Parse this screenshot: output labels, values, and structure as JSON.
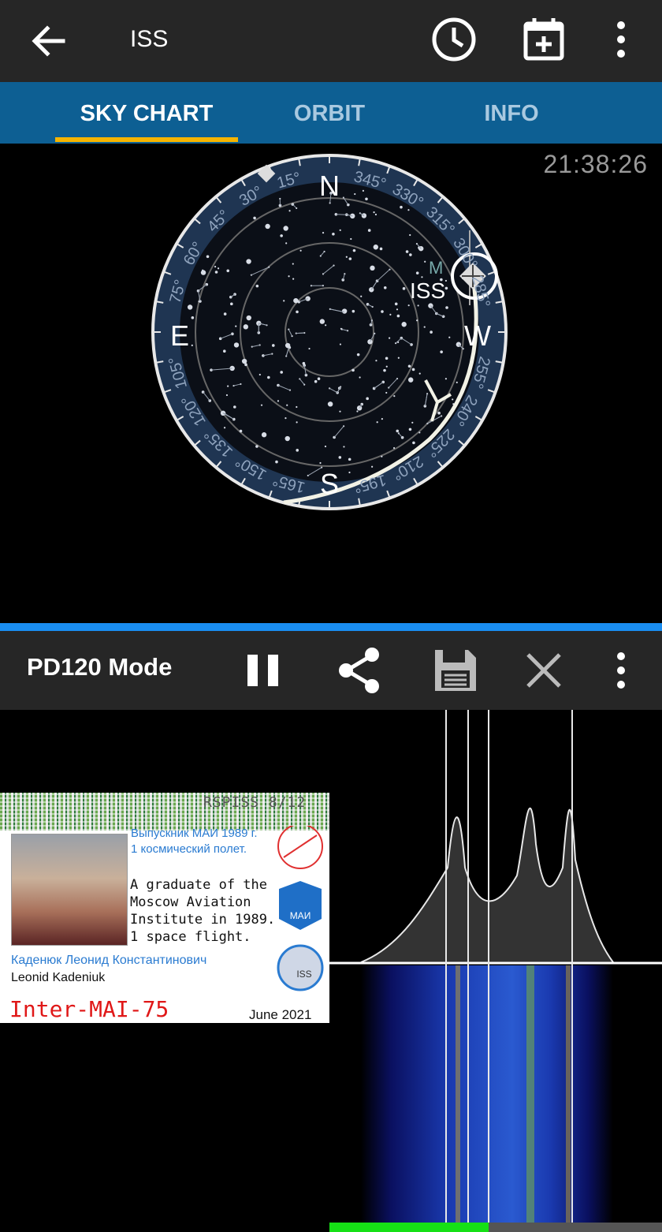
{
  "app_bar": {
    "title": "ISS"
  },
  "tabs": [
    {
      "label": "SKY CHART",
      "active": true
    },
    {
      "label": "ORBIT",
      "active": false
    },
    {
      "label": "INFO",
      "active": false
    }
  ],
  "sky_chart": {
    "time": "21:38:26",
    "cardinals": {
      "n": "N",
      "e": "E",
      "s": "S",
      "w": "W"
    },
    "satellite_label": "ISS",
    "moon_label": "M",
    "ring_numbers": [
      "15°",
      "30°",
      "45°",
      "60°",
      "75°",
      "345°",
      "330°",
      "315°",
      "300°",
      "285°",
      "255°",
      "240°",
      "225°",
      "210°",
      "195°",
      "165°",
      "150°",
      "135°",
      "120°",
      "105°"
    ]
  },
  "sstv": {
    "mode": "PD120 Mode",
    "card": {
      "header": "RSPISS 8/12",
      "ru_line1": "Выпускник МАИ 1989 г.",
      "ru_line2": "1 космический полет.",
      "en_line1": "A graduate of the",
      "en_line2": "Moscow Aviation",
      "en_line3": "Institute in 1989.",
      "en_line4": "1 space flight.",
      "ru_name": "Каденюк Леонид Константинович",
      "en_name": "Leonid Kadeniuk",
      "big_title": "Inter-MAI-75",
      "date": "June 2021",
      "mai_logo_text": "МАИ",
      "iss_logo_text": "ISS"
    }
  },
  "icons": {
    "back": "arrow-left-icon",
    "clock": "clock-icon",
    "calendar": "calendar-add-icon",
    "more": "more-vert-icon",
    "pause": "pause-icon",
    "share": "share-icon",
    "save": "save-icon",
    "close": "close-icon"
  },
  "colors": {
    "app_bar": "#262626",
    "tab_bar": "#0d5f93",
    "tab_indicator": "#f5b400",
    "divider": "#1a8df0",
    "signal_level": "#16e016"
  }
}
